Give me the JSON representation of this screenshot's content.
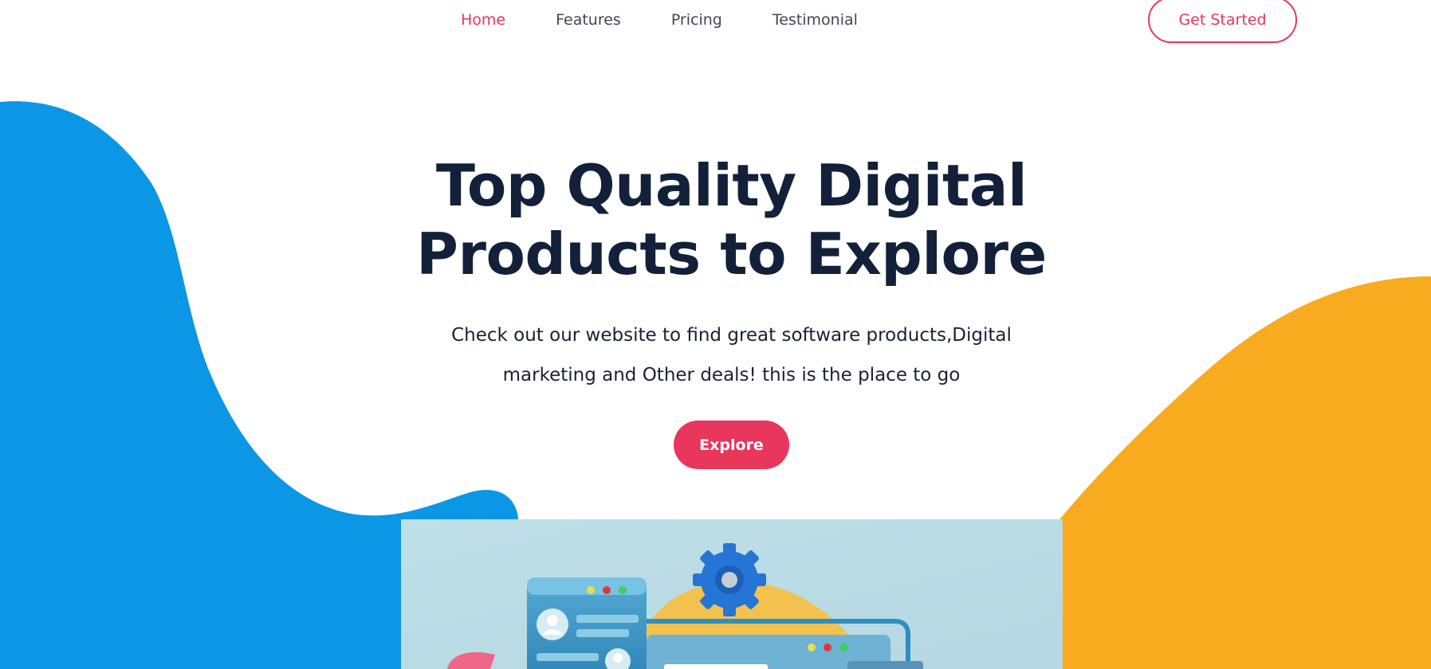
{
  "nav": {
    "items": [
      {
        "label": "Home",
        "active": true
      },
      {
        "label": "Features",
        "active": false
      },
      {
        "label": "Pricing",
        "active": false
      },
      {
        "label": "Testimonial",
        "active": false
      }
    ],
    "cta_label": "Get Started"
  },
  "hero": {
    "title_line1": "Top Quality Digital",
    "title_line2": "Products to Explore",
    "subtitle_line1": "Check out our website to find great software products,Digital",
    "subtitle_line2": "marketing and Other deals! this is the place to go",
    "button_label": "Explore"
  },
  "colors": {
    "accent": "#e8365d",
    "heading": "#13203a",
    "blue_blob": "#0b97e5",
    "orange_blob": "#f8ab1e",
    "image_bg": "#bcdde6"
  },
  "icons": [
    "gear-icon",
    "user-avatar-icon",
    "window-dots-icon"
  ]
}
